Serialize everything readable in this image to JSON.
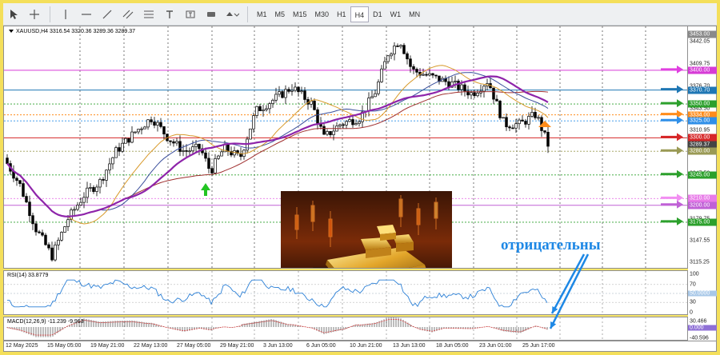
{
  "toolbar": {
    "timeframes": [
      "M1",
      "M5",
      "M15",
      "M30",
      "H1",
      "H4",
      "D1",
      "W1",
      "MN"
    ],
    "active_timeframe": "H4"
  },
  "chart": {
    "symbol_info": "XAUUSD,H4  3316.54 3320.36 3289.36 3289.37",
    "price_ticks": [
      "3453.00",
      "3442.05",
      "3409.75",
      "3376.70",
      "3343.50",
      "3310.95",
      "3280.40",
      "3247.50",
      "3212.15",
      "3179.75",
      "3147.55",
      "3115.25"
    ],
    "level_tags": [
      {
        "label": "3453.00",
        "color": "#8a8a8a",
        "price": 3453.0
      },
      {
        "label": "3400.00",
        "color": "#d63bd6",
        "price": 3400.0
      },
      {
        "label": "3370.70",
        "color": "#1f77b4",
        "price": 3370.7
      },
      {
        "label": "3350.00",
        "color": "#2ca02c",
        "price": 3350.0
      },
      {
        "label": "3334.00",
        "color": "#ff8c1a",
        "price": 3334.0
      },
      {
        "label": "3325.00",
        "color": "#2f8fe8",
        "price": 3325.0
      },
      {
        "label": "3300.00",
        "color": "#d62728",
        "price": 3300.0
      },
      {
        "label": "3289.37",
        "color": "#444444",
        "price": 3289.37
      },
      {
        "label": "3280.00",
        "color": "#9a9a55",
        "price": 3280.0
      },
      {
        "label": "3245.00",
        "color": "#2ca02c",
        "price": 3245.0
      },
      {
        "label": "3210.00",
        "color": "#e87be8",
        "price": 3210.0
      },
      {
        "label": "3200.00",
        "color": "#c061d6",
        "price": 3200.0
      },
      {
        "label": "3175.00",
        "color": "#2ca02c",
        "price": 3175.0
      }
    ],
    "overlay_text": "отрицательны"
  },
  "rsi": {
    "title": "RSI(14) 33.8779",
    "ticks": [
      "100",
      "70",
      "50.0000",
      "30",
      "0"
    ]
  },
  "macd": {
    "title": "MACD(12,26,9) -11.239 -9.963",
    "ticks": [
      "30.466",
      "0.000",
      "-40.596"
    ]
  },
  "time_axis": [
    "12 May 2025",
    "15 May 05:00",
    "19 May 21:00",
    "22 May 13:00",
    "27 May 05:00",
    "29 May 21:00",
    "3 Jun 13:00",
    "6 Jun 05:00",
    "10 Jun 21:00",
    "13 Jun 13:00",
    "18 Jun 05:00",
    "23 Jun 01:00",
    "25 Jun 17:00"
  ],
  "colors": {
    "bull": "#2f8f2f",
    "candle": "#000000",
    "ma_purple": "#8e24aa",
    "ma_orange": "#d89a2b",
    "ma_darkblue": "#3b4f9c",
    "ma_darkred": "#a03030",
    "rsi_line": "#2a7fd6",
    "accent_blue": "#1e88e5"
  }
}
